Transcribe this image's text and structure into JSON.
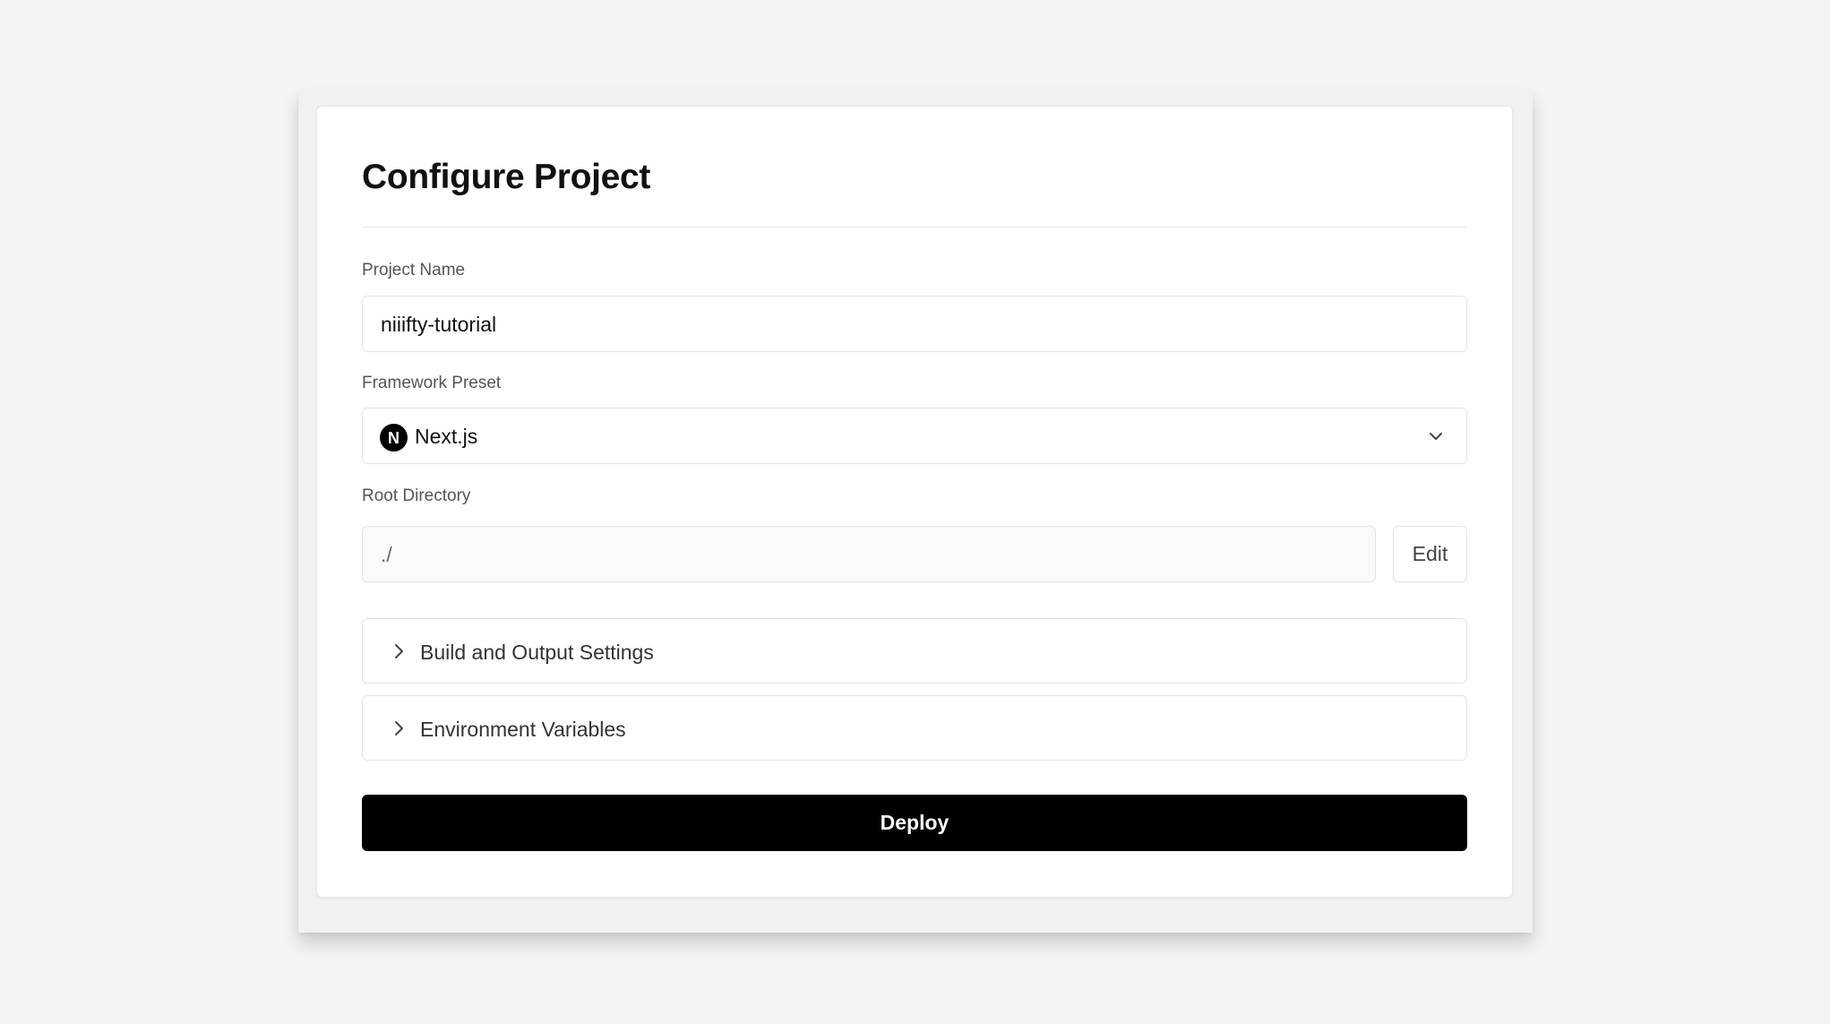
{
  "page": {
    "title": "Configure Project"
  },
  "form": {
    "project_name": {
      "label": "Project Name",
      "value": "niiifty-tutorial"
    },
    "framework_preset": {
      "label": "Framework Preset",
      "selected": "Next.js",
      "icon": "nextjs-logo-icon",
      "icon_glyph": "N"
    },
    "root_directory": {
      "label": "Root Directory",
      "value": "./",
      "edit_label": "Edit"
    }
  },
  "sections": [
    {
      "label": "Build and Output Settings",
      "icon": "chevron-right-icon"
    },
    {
      "label": "Environment Variables",
      "icon": "chevron-right-icon"
    }
  ],
  "actions": {
    "deploy_label": "Deploy"
  },
  "colors": {
    "background": "#f3f4f3",
    "card": "#ffffff",
    "primary_button": "#000000",
    "primary_button_text": "#ffffff",
    "border": "#e3e3e3"
  }
}
